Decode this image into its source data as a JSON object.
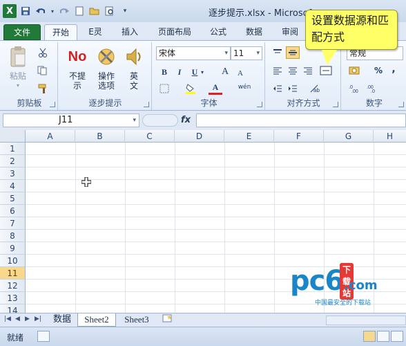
{
  "title_bar": {
    "title": "逐步提示.xlsx - Microsof",
    "app_icon": "X",
    "qat_items": [
      "save-icon",
      "undo-icon",
      "redo-icon",
      "new-icon",
      "open-icon",
      "print-preview-icon",
      "customize-icon"
    ]
  },
  "tabs": [
    {
      "label": "文件"
    },
    {
      "label": "开始"
    },
    {
      "label": "E灵"
    },
    {
      "label": "插入"
    },
    {
      "label": "页面布局"
    },
    {
      "label": "公式"
    },
    {
      "label": "数据"
    },
    {
      "label": "审阅"
    }
  ],
  "ribbon": {
    "clipboard": {
      "label": "剪贴板",
      "paste": "粘贴"
    },
    "step_hint": {
      "label": "逐步提示",
      "no_hint": "不提示",
      "options": "操作选项",
      "english": "英文",
      "no_icon_text": "No"
    },
    "font": {
      "label": "字体",
      "name": "宋体",
      "size": "11",
      "bold": "B",
      "italic": "I",
      "underline": "U",
      "grow": "A",
      "shrink": "A",
      "font_color": "A",
      "phonetic": "wén"
    },
    "alignment": {
      "label": "对齐方式"
    },
    "number": {
      "label": "数字",
      "format": "常规",
      "percent": "%",
      "comma": ","
    }
  },
  "callout": {
    "text": "设置数据源和匹配方式"
  },
  "formula_bar": {
    "name_box": "J11",
    "fx": "fx",
    "content": ""
  },
  "grid": {
    "columns": [
      "A",
      "B",
      "C",
      "D",
      "E",
      "F",
      "G",
      "H"
    ],
    "rows": [
      "1",
      "2",
      "3",
      "4",
      "5",
      "6",
      "7",
      "8",
      "9",
      "10",
      "11",
      "12",
      "13",
      "14"
    ],
    "active_row": "11"
  },
  "watermark": {
    "brand": "pc6",
    "badge": "下载站",
    "domain": ".com",
    "tagline": "中国最安全的下载站"
  },
  "sheet_tabs": [
    {
      "label": "数据"
    },
    {
      "label": "Sheet2"
    },
    {
      "label": "Sheet3"
    }
  ],
  "status": {
    "text": "就绪"
  },
  "colors": {
    "file_tab": "#217a3a",
    "callout": "#ffff66",
    "active_row": "#f7d88c",
    "watermark": "#1a86c8"
  }
}
